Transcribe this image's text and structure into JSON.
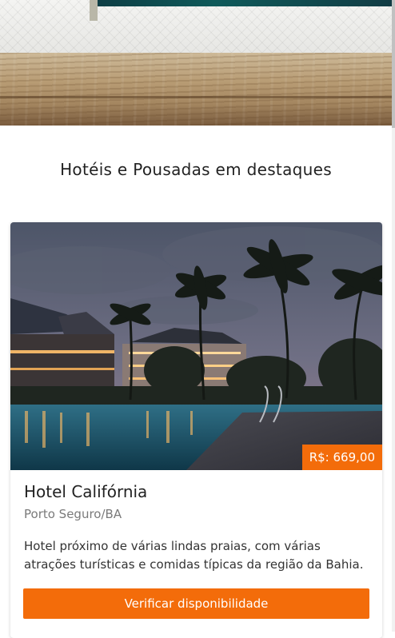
{
  "section": {
    "title": "Hotéis e Pousadas em destaques"
  },
  "hotel_card": {
    "price": "R$: 669,00",
    "name": "Hotel Califórnia",
    "location": "Porto Seguro/BA",
    "description": "Hotel próximo de várias lindas praias, com várias atrações turísticas e comidas típicas da região da Bahia.",
    "cta_label": "Verificar disponibilidade"
  },
  "colors": {
    "accent": "#f36c0a",
    "title_text": "#222222",
    "muted_text": "#7a7a7a"
  }
}
